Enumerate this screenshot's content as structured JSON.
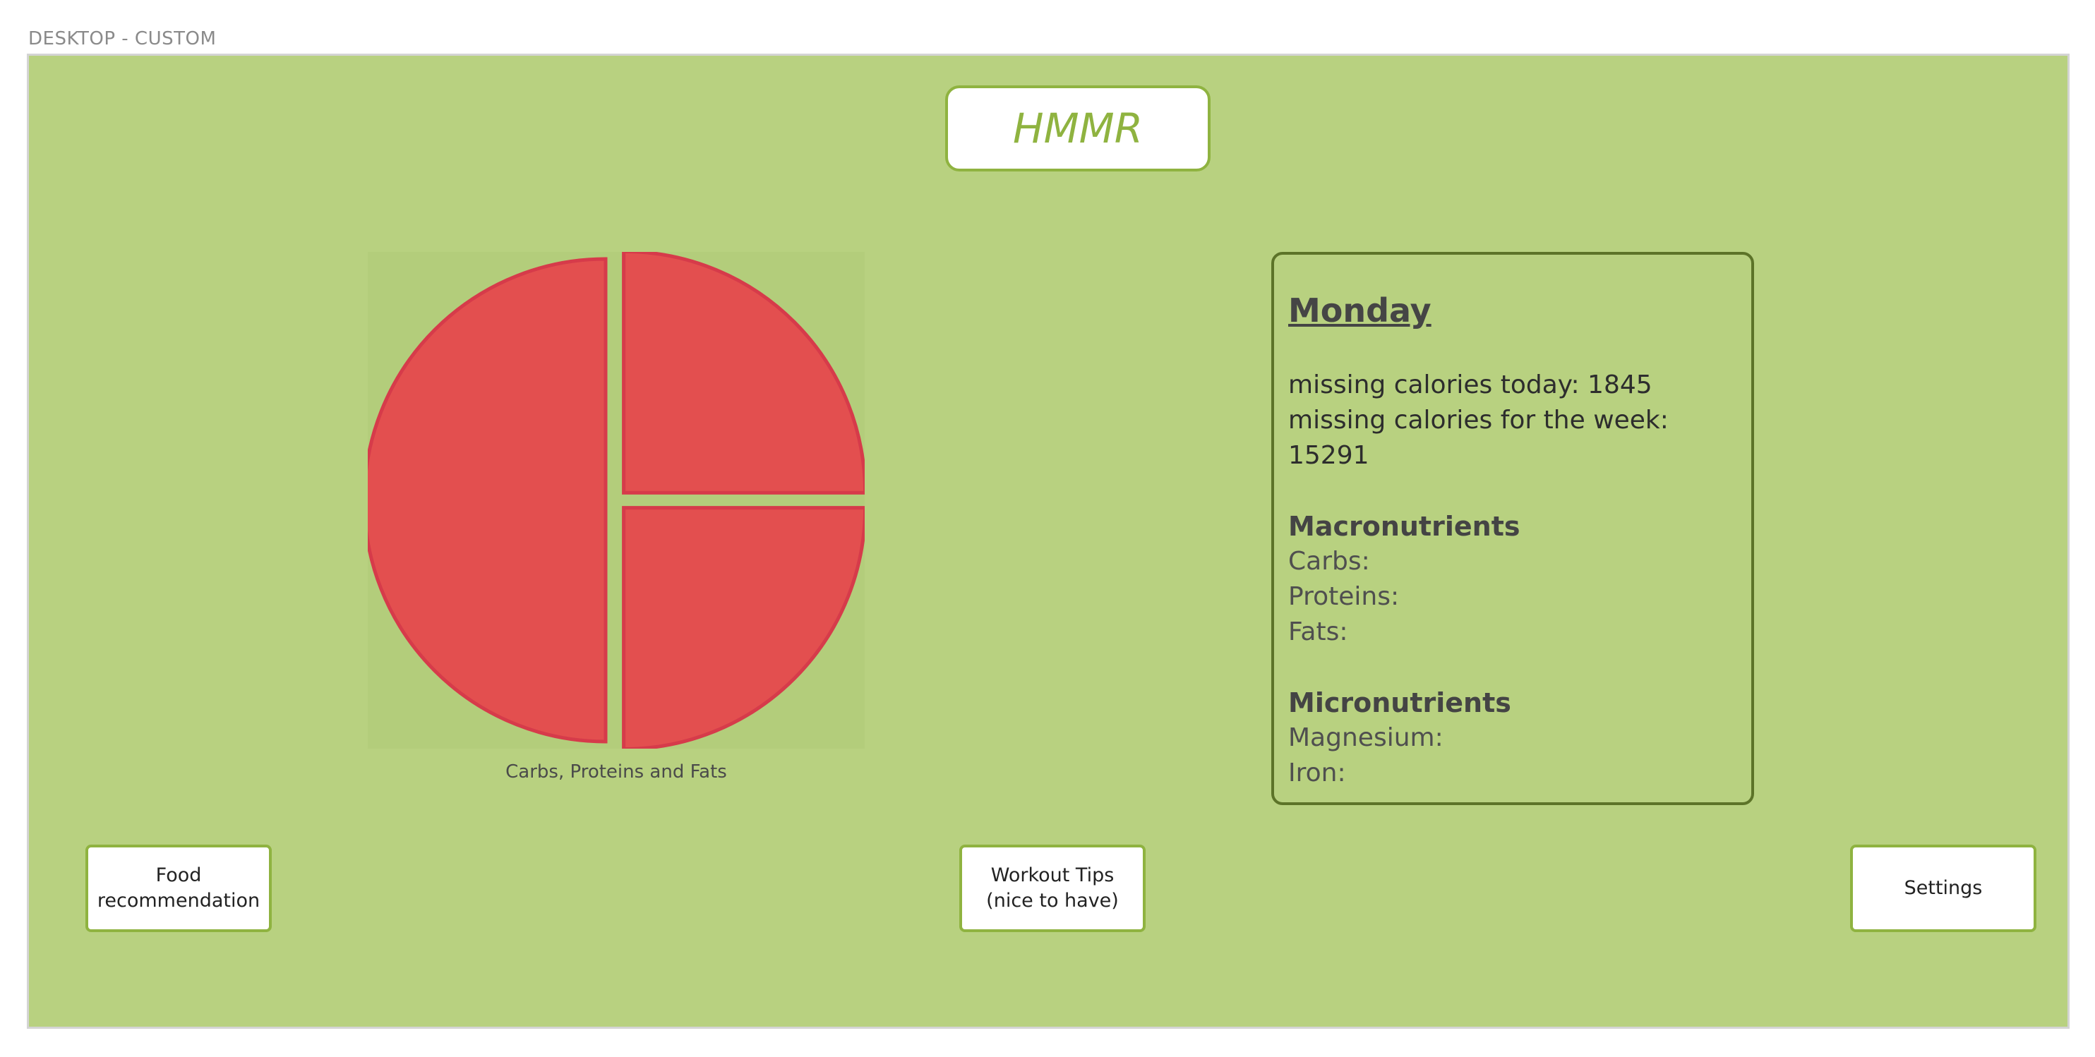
{
  "frame": {
    "label": "DESKTOP - CUSTOM"
  },
  "header": {
    "logo_text": "HMMR"
  },
  "chart": {
    "caption": "Carbs, Proteins and Fats",
    "colors": {
      "slice_fill": "#e34f4f",
      "slice_stroke": "#d63b4a",
      "background": "#b3cd7b"
    }
  },
  "chart_data": {
    "type": "pie",
    "categories": [
      "",
      "",
      ""
    ],
    "values": [
      50,
      25,
      25
    ],
    "title": "Carbs, Proteins and Fats"
  },
  "summary": {
    "day": "Monday",
    "missing_today": "missing calories today: 1845",
    "missing_week": "missing calories for the week: 15291",
    "macro_title": "Macronutrients",
    "carbs": "Carbs:",
    "proteins": "Proteins:",
    "fats": "Fats:",
    "micro_title": "Micronutrients",
    "magnesium": "Magnesium:",
    "iron": "Iron:"
  },
  "buttons": {
    "food": "Food\nrecommendation",
    "workout": "Workout Tips\n(nice to have)",
    "settings": "Settings"
  },
  "colors": {
    "frame_bg": "#b8d180",
    "accent": "#8fb340",
    "card_border": "#5c7328"
  }
}
